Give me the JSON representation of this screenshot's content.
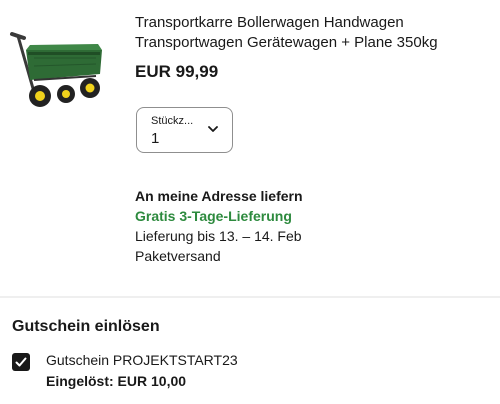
{
  "product": {
    "title": "Transportkarre Bollerwagen Handwagen Transportwagen Gerätewagen + Plane 350kg",
    "price": "EUR 99,99",
    "image_icon": "garden-cart-icon"
  },
  "quantity": {
    "label": "Stückz...",
    "value": "1",
    "icon": "chevron-down-icon"
  },
  "delivery": {
    "heading": "An meine Adresse liefern",
    "free_label": "Gratis 3-Tage-Lieferung",
    "date_text": "Lieferung bis 13. – 14. Feb",
    "method": "Paketversand"
  },
  "coupon": {
    "heading": "Gutschein einlösen",
    "name": "Gutschein PROJEKTSTART23",
    "redeemed": "Eingelöst: EUR 10,00",
    "checked": true
  },
  "colors": {
    "text": "#191919",
    "free_delivery": "#2d8a3e",
    "cart_body": "#2e6b35",
    "wheel": "#f0d21c"
  }
}
